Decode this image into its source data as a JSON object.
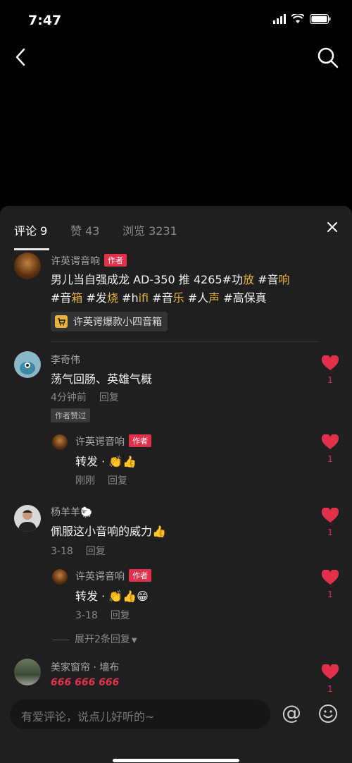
{
  "status_bar": {
    "time": "7:47"
  },
  "tabs": {
    "comments": "评论 9",
    "likes": "赞 43",
    "views": "浏览 3231"
  },
  "comments": [
    {
      "author": "许英谔音响",
      "badge": "作者",
      "text_line1_prefix": "男儿当自强成龙 AD-350 推 4265#功",
      "text_line1_hl1": "放",
      "text_line1_mid": " #音",
      "text_line1_hl2": "响",
      "text_line2_a": "#音",
      "text_line2_b": "箱",
      "text_line2_c": " #发",
      "text_line2_d": "烧",
      "text_line2_e": " #h",
      "text_line2_f": "ifi",
      "text_line2_g": " #音",
      "text_line2_h": "乐",
      "text_line2_i": " #人",
      "text_line2_j": "声",
      "text_line2_k": " #高保真",
      "product_chip": "许英谔爆款小四音箱"
    },
    {
      "author": "李奇伟",
      "text": "荡气回肠、英雄气概",
      "time": "4分钟前",
      "reply": "回复",
      "liked_badge": "作者赞过",
      "likes": "1"
    },
    {
      "author": "许英谔音响",
      "badge": "作者",
      "text": "转发 · 👏👍",
      "time": "刚刚",
      "reply": "回复",
      "likes": "1"
    },
    {
      "author": "杨羊羊🐑",
      "text": "佩服这小音响的威力👍",
      "time": "3-18",
      "reply": "回复",
      "likes": "1"
    },
    {
      "author": "许英谔音响",
      "badge": "作者",
      "text": "转发 · 👏👍😁",
      "time": "3-18",
      "reply": "回复",
      "likes": "1"
    },
    {
      "author": "美家窗帘 · 墙布",
      "text": "666 666 666",
      "likes": "1"
    }
  ],
  "expand_replies": "展开2条回复",
  "input": {
    "placeholder": "有爱评论，说点儿好听的~"
  },
  "colors": {
    "accent": "#e0304a",
    "highlight": "#e9b23c",
    "sheet_bg": "#1f1f1f"
  }
}
